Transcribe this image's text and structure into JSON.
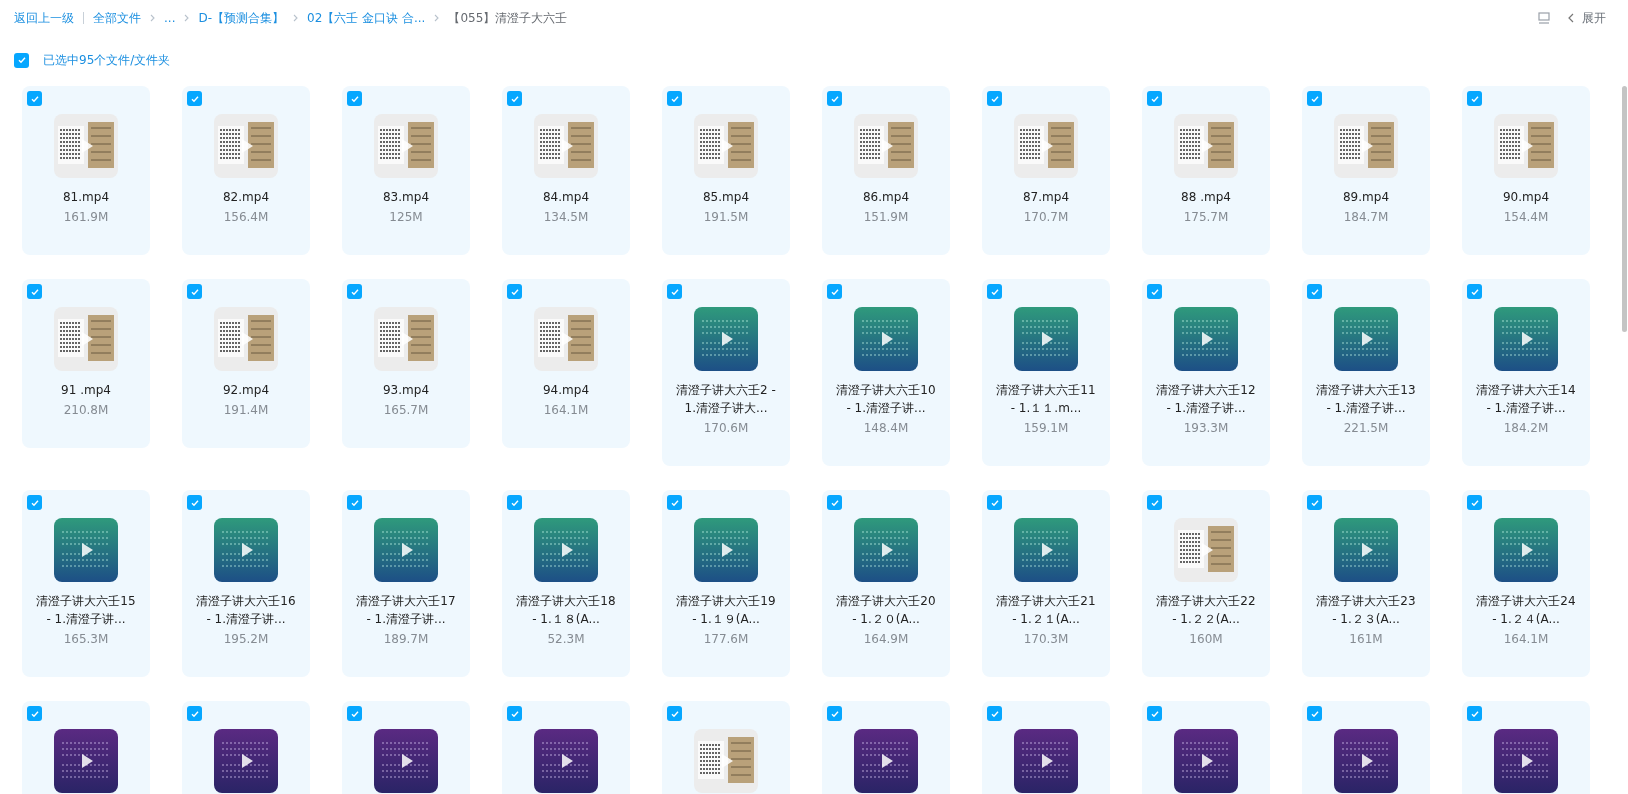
{
  "breadcrumb": {
    "back": "返回上一级",
    "items": [
      {
        "label": "全部文件",
        "current": false
      },
      {
        "label": "...",
        "current": false
      },
      {
        "label": "D-【预测合集】",
        "current": false
      },
      {
        "label": "02【六壬 金口诀 合...",
        "current": false
      },
      {
        "label": "【055】清澄子大六壬",
        "current": true
      }
    ]
  },
  "toolbar": {
    "expand": "展开"
  },
  "selection": {
    "checked": true,
    "label": "已选中95个文件/文件夹"
  },
  "files": [
    {
      "kind": "scan",
      "checked": true,
      "name": "81.mp4",
      "size": "161.9M"
    },
    {
      "kind": "scan",
      "checked": true,
      "name": "82.mp4",
      "size": "156.4M"
    },
    {
      "kind": "scan",
      "checked": true,
      "name": "83.mp4",
      "size": "125M"
    },
    {
      "kind": "scan",
      "checked": true,
      "name": "84.mp4",
      "size": "134.5M"
    },
    {
      "kind": "scan",
      "checked": true,
      "name": "85.mp4",
      "size": "191.5M"
    },
    {
      "kind": "scan",
      "checked": true,
      "name": "86.mp4",
      "size": "151.9M"
    },
    {
      "kind": "scan",
      "checked": true,
      "name": "87.mp4",
      "size": "170.7M"
    },
    {
      "kind": "scan",
      "checked": true,
      "name": "88 .mp4",
      "size": "175.7M"
    },
    {
      "kind": "scan",
      "checked": true,
      "name": "89.mp4",
      "size": "184.7M"
    },
    {
      "kind": "scan",
      "checked": true,
      "name": "90.mp4",
      "size": "154.4M"
    },
    {
      "kind": "scan",
      "checked": true,
      "name": "91 .mp4",
      "size": "210.8M"
    },
    {
      "kind": "scan",
      "checked": true,
      "name": "92.mp4",
      "size": "191.4M"
    },
    {
      "kind": "scan",
      "checked": true,
      "name": "93.mp4",
      "size": "165.7M"
    },
    {
      "kind": "scan",
      "checked": true,
      "name": "94.mp4",
      "size": "164.1M"
    },
    {
      "kind": "teal",
      "checked": true,
      "name": "清澄子讲大六壬2 -\n1.清澄子讲大...",
      "size": "170.6M"
    },
    {
      "kind": "teal",
      "checked": true,
      "name": "清澄子讲大六壬10\n- 1.清澄子讲...",
      "size": "148.4M"
    },
    {
      "kind": "teal",
      "checked": true,
      "name": "清澄子讲大六壬11\n- 1.１１.m...",
      "size": "159.1M"
    },
    {
      "kind": "teal",
      "checked": true,
      "name": "清澄子讲大六壬12\n- 1.清澄子讲...",
      "size": "193.3M"
    },
    {
      "kind": "teal",
      "checked": true,
      "name": "清澄子讲大六壬13\n- 1.清澄子讲...",
      "size": "221.5M"
    },
    {
      "kind": "teal",
      "checked": true,
      "name": "清澄子讲大六壬14\n- 1.清澄子讲...",
      "size": "184.2M"
    },
    {
      "kind": "teal",
      "checked": true,
      "name": "清澄子讲大六壬15\n- 1.清澄子讲...",
      "size": "165.3M"
    },
    {
      "kind": "teal",
      "checked": true,
      "name": "清澄子讲大六壬16\n- 1.清澄子讲...",
      "size": "195.2M"
    },
    {
      "kind": "teal",
      "checked": true,
      "name": "清澄子讲大六壬17\n- 1.清澄子讲...",
      "size": "189.7M"
    },
    {
      "kind": "teal",
      "checked": true,
      "name": "清澄子讲大六壬18\n- 1.１８(A...",
      "size": "52.3M"
    },
    {
      "kind": "teal",
      "checked": true,
      "name": "清澄子讲大六壬19\n- 1.１９(A...",
      "size": "177.6M"
    },
    {
      "kind": "teal",
      "checked": true,
      "name": "清澄子讲大六壬20\n- 1.２０(A...",
      "size": "164.9M"
    },
    {
      "kind": "teal",
      "checked": true,
      "name": "清澄子讲大六壬21\n- 1.２１(A...",
      "size": "170.3M"
    },
    {
      "kind": "scan",
      "checked": true,
      "name": "清澄子讲大六壬22\n- 1.２２(A...",
      "size": "160M"
    },
    {
      "kind": "teal",
      "checked": true,
      "name": "清澄子讲大六壬23\n- 1.２３(A...",
      "size": "161M"
    },
    {
      "kind": "teal",
      "checked": true,
      "name": "清澄子讲大六壬24\n- 1.２４(A...",
      "size": "164.1M"
    },
    {
      "kind": "purple",
      "checked": true
    },
    {
      "kind": "purple",
      "checked": true
    },
    {
      "kind": "purple",
      "checked": true
    },
    {
      "kind": "purple",
      "checked": true
    },
    {
      "kind": "scan",
      "checked": true
    },
    {
      "kind": "purple",
      "checked": true
    },
    {
      "kind": "purple",
      "checked": true
    },
    {
      "kind": "purple",
      "checked": true
    },
    {
      "kind": "purple",
      "checked": true
    },
    {
      "kind": "purple",
      "checked": true
    }
  ]
}
